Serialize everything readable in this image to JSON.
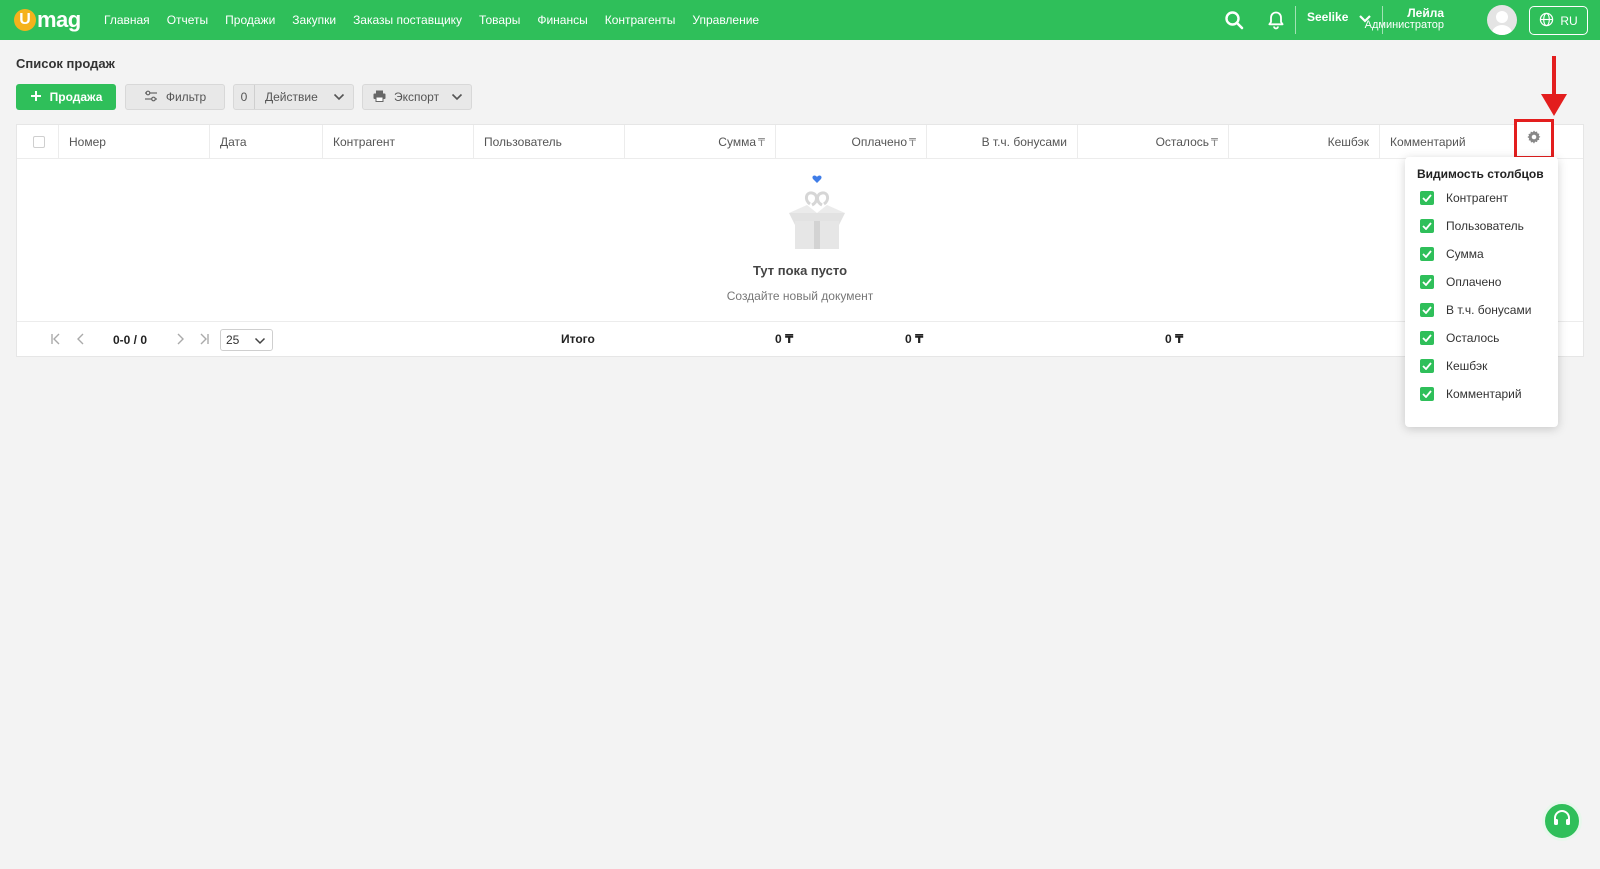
{
  "app": {
    "logo_letter": "U",
    "logo_text": "mag"
  },
  "nav": {
    "items": [
      "Главная",
      "Отчеты",
      "Продажи",
      "Закупки",
      "Заказы поставщику",
      "Товары",
      "Финансы",
      "Контрагенты",
      "Управление"
    ]
  },
  "header": {
    "store": "Seelike",
    "user_name": "Лейла",
    "user_role": "Администратор",
    "lang": "RU"
  },
  "page": {
    "title": "Список продаж"
  },
  "toolbar": {
    "sale_label": "Продажа",
    "filter_label": "Фильтр",
    "action_count": "0",
    "action_label": "Действие",
    "export_label": "Экспорт"
  },
  "table": {
    "columns": {
      "number": "Номер",
      "date": "Дата",
      "counterparty": "Контрагент",
      "user": "Пользователь",
      "sum": "Сумма",
      "paid": "Оплачено",
      "bonuses": "В т.ч. бонусами",
      "remaining": "Осталось",
      "cashback": "Кешбэк",
      "comment": "Комментарий"
    },
    "currency": "₸",
    "empty_title": "Тут пока пусто",
    "empty_subtitle": "Создайте новый документ"
  },
  "footer": {
    "page_info": "0-0 / 0",
    "page_size": "25",
    "total_label": "Итого",
    "total_sum": "0 ₸",
    "total_paid": "0 ₸",
    "total_remaining": "0 ₸"
  },
  "popover": {
    "title": "Видимость столбцов",
    "items": [
      "Контрагент",
      "Пользователь",
      "Сумма",
      "Оплачено",
      "В т.ч. бонусами",
      "Осталось",
      "Кешбэк",
      "Комментарий"
    ]
  },
  "colors": {
    "brand_green": "#2fbf5a",
    "logo_orange": "#f5b21c",
    "highlight_red": "#e31e1e"
  }
}
